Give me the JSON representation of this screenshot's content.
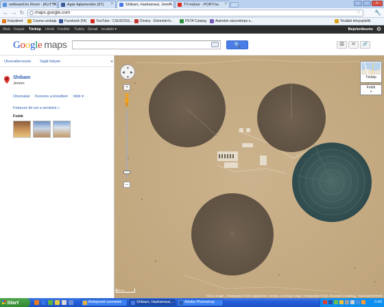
{
  "browser": {
    "tabs": [
      {
        "title": "netboard.hu fórum - [KUTYA",
        "icon_color": "#5b8fd8"
      },
      {
        "title": "Agár-fajtamentés (57)",
        "icon_color": "#3b5998"
      },
      {
        "title": "Shibam, Hadramaut, Jemen",
        "icon_color": "#4a7de8"
      },
      {
        "title": "TV-műsor - PORT.hu",
        "icon_color": "#d62d20"
      }
    ],
    "url": "maps.google.com",
    "bookmarks": [
      {
        "label": "Kutyaknet",
        "icon_color": "#e07a1f"
      },
      {
        "label": "Csoma szobája",
        "icon_color": "#d9a21b"
      },
      {
        "label": "Facebook (54)",
        "icon_color": "#3b5998"
      },
      {
        "label": "YouTube - CSUGOSS...",
        "icon_color": "#d62d20"
      },
      {
        "label": "Dívány - Életmód+Ív...",
        "icon_color": "#c0392b"
      },
      {
        "label": "PETA Catalog",
        "icon_color": "#2f8f3b"
      },
      {
        "label": "Alaindok vászonképe s...",
        "icon_color": "#7a5ab8"
      },
      {
        "label": "További könyvjelzők",
        "icon_color": "#d9a21b"
      }
    ]
  },
  "gbar": {
    "items": [
      "Web",
      "Képek",
      "Térkép",
      "Hírek",
      "Fordító",
      "Tudós",
      "Gmail",
      "további ▾"
    ],
    "active": "Térkép",
    "signin": "Bejelentkezés"
  },
  "header": {
    "logo_text": "Google",
    "logo_product": "maps",
    "search_value": "",
    "search_button": "🔍",
    "tools": [
      "🖨",
      "✉",
      "🔗"
    ]
  },
  "panel": {
    "tabs": [
      "Útvonaltervezés",
      "Saját helyek"
    ],
    "place_name": "Shibam",
    "place_country": "Jemen",
    "links": [
      "Útvonalak",
      "Keresés a közelben",
      "több ▾"
    ],
    "explore": "Fedezze fel ezt a területet »",
    "photos_label": "Fotók"
  },
  "map": {
    "type_label": "Térkép",
    "photos_toggle": "Fotók",
    "scale_label": "200 m",
    "attribution": "©2011 Google - Térképadatok ©2011 DigitalGlobe, GeoEye, Cnes/Spot Image, Térképadatok ©2011 Geocentre Consulting - Használati feltételek"
  },
  "taskbar": {
    "start": "Start",
    "tasks": [
      {
        "label": "Befejezett üzenetek",
        "icon_color": "#e8b23a"
      },
      {
        "label": "Shibam, Hadramaut,...",
        "icon_color": "#4a7de8"
      },
      {
        "label": "Adobe Photoshop",
        "icon_color": "#3160a8"
      }
    ],
    "clock": "0:43"
  }
}
